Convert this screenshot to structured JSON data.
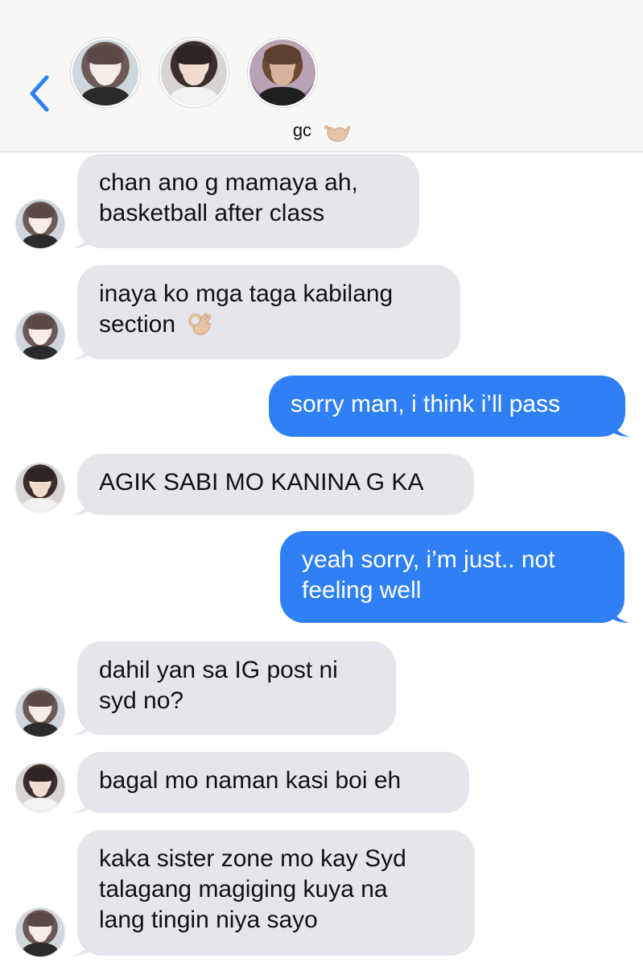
{
  "header": {
    "back_icon": "chevron-left-icon",
    "group_name": "gc",
    "group_emoji": "call-me-hand-icon",
    "participants": [
      {
        "avatar": "participant-avatar-1"
      },
      {
        "avatar": "participant-avatar-2"
      },
      {
        "avatar": "participant-avatar-3"
      }
    ]
  },
  "messages": [
    {
      "direction": "received",
      "sender": "participant-1",
      "lines": [
        "chan ano g mamaya ah,",
        "basketball after class"
      ]
    },
    {
      "direction": "received",
      "sender": "participant-1",
      "lines": [
        "inaya ko mga taga kabilang",
        "section"
      ],
      "emoji": "ok-hand-icon"
    },
    {
      "direction": "sent",
      "lines": [
        "sorry man, i think i’ll pass"
      ]
    },
    {
      "direction": "received",
      "sender": "participant-2",
      "lines": [
        "AGIK SABI MO KANINA G KA"
      ]
    },
    {
      "direction": "sent",
      "lines": [
        "yeah sorry, i’m just.. not",
        "feeling well"
      ]
    },
    {
      "direction": "received",
      "sender": "participant-1",
      "lines": [
        "dahil yan sa IG post ni",
        "syd no?"
      ]
    },
    {
      "direction": "received",
      "sender": "participant-2",
      "lines": [
        "bagal mo naman kasi boi eh"
      ]
    },
    {
      "direction": "received",
      "sender": "participant-1",
      "lines": [
        "kaka sister zone mo kay Syd",
        "talagang magiging kuya na",
        "lang tingin niya sayo"
      ]
    }
  ],
  "colors": {
    "header_bg": "#f7f7f7",
    "received_bubble": "#e6e5eb",
    "sent_bubble": "#2f80f5",
    "accent": "#2f80f5"
  }
}
